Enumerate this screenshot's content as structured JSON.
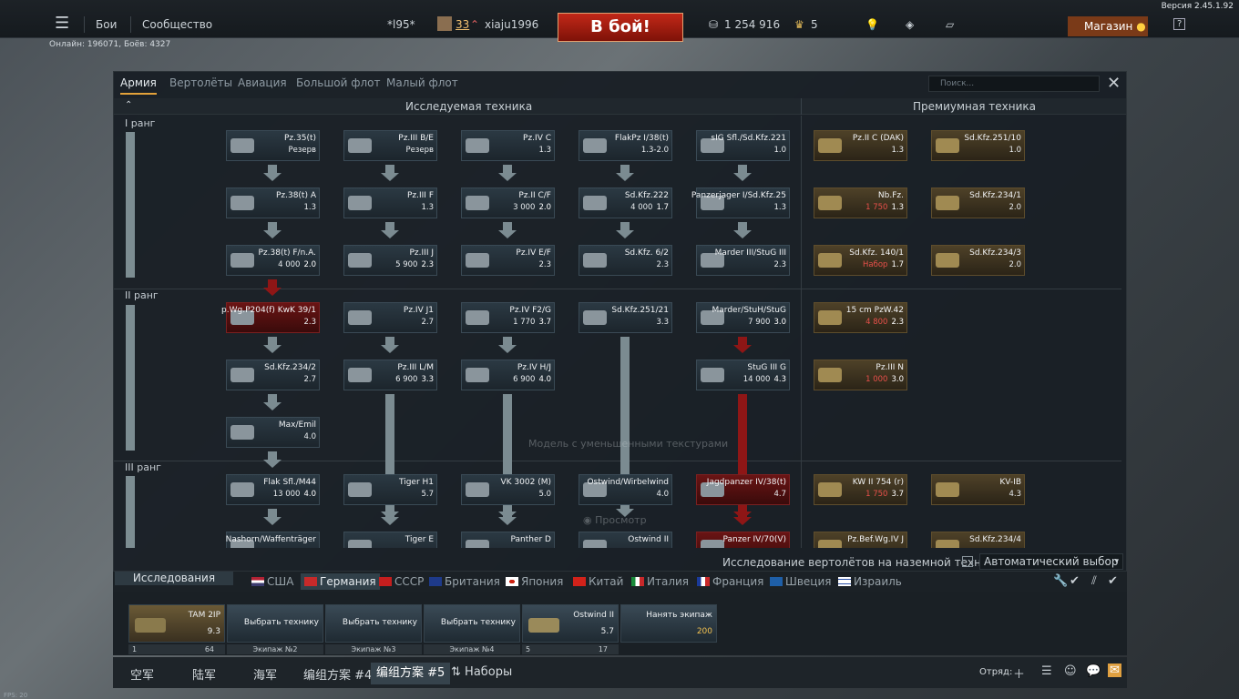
{
  "version": "Версия 2.45.1.92",
  "topbar": {
    "menu_icon": "hamburger-icon",
    "battles": "Бои",
    "community": "Сообщество",
    "squad_tag": "*l95*",
    "level": "33",
    "nickname": "xiaju1996",
    "battle_button": "В бой!",
    "silver": "1 254 916",
    "gold": "5",
    "shop": "Магазин",
    "help": "?"
  },
  "online": "Онлайн: 196071, Боёв: 4327",
  "window": {
    "tabs": [
      "Армия",
      "Вертолёты",
      "Авиация",
      "Большой флот",
      "Малый флот"
    ],
    "search_placeholder": "Поиск...",
    "researched_header": "Исследуемая техника",
    "premium_header": "Премиумная техника"
  },
  "ranks": [
    "I ранг",
    "II ранг",
    "III ранг"
  ],
  "vehicles": [
    {
      "name": "Pz.35(t)",
      "info": "Резерв",
      "br": "",
      "kind": "normal"
    },
    {
      "name": "Pz.III B/E",
      "info": "Резерв",
      "br": "",
      "kind": "normal"
    },
    {
      "name": "Pz.IV C",
      "info": "1.3",
      "br": "",
      "kind": "normal"
    },
    {
      "name": "FlakPz I/38(t)",
      "info": "1.3-2.0",
      "br": "",
      "kind": "normal"
    },
    {
      "name": "sIG Sfl./Sd.Kfz.221",
      "info": "1.0",
      "br": "",
      "kind": "normal"
    },
    {
      "name": "Pz.II C (DAK)",
      "info": "1.3",
      "br": "",
      "kind": "prem"
    },
    {
      "name": "Sd.Kfz.251/10",
      "info": "1.0",
      "br": "",
      "kind": "prem"
    },
    {
      "name": "Pz.38(t) A",
      "info": "1.3",
      "br": "",
      "kind": "normal"
    },
    {
      "name": "Pz.III F",
      "info": "1.3",
      "br": "",
      "kind": "normal"
    },
    {
      "name": "Pz.II C/F",
      "info": "3 000",
      "br": "2.0",
      "kind": "normal"
    },
    {
      "name": "Sd.Kfz.222",
      "info": "4 000",
      "br": "1.7",
      "kind": "normal"
    },
    {
      "name": "Panzerjager I/Sd.Kfz.25",
      "info": "1.3",
      "br": "",
      "kind": "normal"
    },
    {
      "name": "Nb.Fz.",
      "info": "1 750",
      "br": "1.3",
      "kind": "prem"
    },
    {
      "name": "Sd.Kfz.234/1",
      "info": "2.0",
      "br": "",
      "kind": "prem"
    },
    {
      "name": "Pz.38(t) F/n.A.",
      "info": "4 000",
      "br": "2.0",
      "kind": "normal"
    },
    {
      "name": "Pz.III J",
      "info": "5 900",
      "br": "2.3",
      "kind": "normal"
    },
    {
      "name": "Pz.IV E/F",
      "info": "2.3",
      "br": "",
      "kind": "normal"
    },
    {
      "name": "Sd.Kfz. 6/2",
      "info": "2.3",
      "br": "",
      "kind": "normal"
    },
    {
      "name": "Marder III/StuG III",
      "info": "2.3",
      "br": "",
      "kind": "normal"
    },
    {
      "name": "Sd.Kfz. 140/1",
      "info": "Набор",
      "br": "1.7",
      "kind": "prem"
    },
    {
      "name": "Sd.Kfz.234/3",
      "info": "2.0",
      "br": "",
      "kind": "prem"
    },
    {
      "name": "p.Wg.P204(f) KwK 39/1",
      "info": "2.3",
      "br": "",
      "kind": "red"
    },
    {
      "name": "Pz.IV J1",
      "info": "2.7",
      "br": "",
      "kind": "normal"
    },
    {
      "name": "Pz.IV F2/G",
      "info": "1 770",
      "br": "3.7",
      "kind": "normal"
    },
    {
      "name": "Sd.Kfz.251/21",
      "info": "3.3",
      "br": "",
      "kind": "normal"
    },
    {
      "name": "Marder/StuH/StuG",
      "info": "7 900",
      "br": "3.0",
      "kind": "normal"
    },
    {
      "name": "15 cm PzW.42",
      "info": "4 800",
      "br": "2.3",
      "kind": "prem"
    },
    {
      "name": "Sd.Kfz.234/2",
      "info": "2.7",
      "br": "",
      "kind": "normal"
    },
    {
      "name": "Pz.III L/M",
      "info": "6 900",
      "br": "3.3",
      "kind": "normal"
    },
    {
      "name": "Pz.IV H/J",
      "info": "6 900",
      "br": "4.0",
      "kind": "normal"
    },
    {
      "name": "StuG III G",
      "info": "14 000",
      "br": "4.3",
      "kind": "normal"
    },
    {
      "name": "Pz.III N",
      "info": "1 000",
      "br": "3.0",
      "kind": "prem"
    },
    {
      "name": "Max/Emil",
      "info": "4.0",
      "br": "",
      "kind": "normal"
    },
    {
      "name": "Flak Sfl./M44",
      "info": "13 000",
      "br": "4.0",
      "kind": "normal"
    },
    {
      "name": "Tiger H1",
      "info": "5.7",
      "br": "",
      "kind": "normal"
    },
    {
      "name": "VK 3002 (M)",
      "info": "5.0",
      "br": "",
      "kind": "normal"
    },
    {
      "name": "Ostwind/Wirbelwind",
      "info": "4.0",
      "br": "",
      "kind": "normal"
    },
    {
      "name": "Jagdpanzer IV/38(t)",
      "info": "4.7",
      "br": "",
      "kind": "red"
    },
    {
      "name": "KW II 754 (r)",
      "info": "1 750",
      "br": "3.7",
      "kind": "prem"
    },
    {
      "name": "KV-IB",
      "info": "4.3",
      "br": "",
      "kind": "prem"
    },
    {
      "name": "Nashorn/Waffenträger",
      "info": "",
      "br": "",
      "kind": "normal"
    },
    {
      "name": "Tiger E",
      "info": "",
      "br": "",
      "kind": "normal"
    },
    {
      "name": "Panther D",
      "info": "",
      "br": "",
      "kind": "normal"
    },
    {
      "name": "Ostwind II",
      "info": "",
      "br": "",
      "kind": "normal"
    },
    {
      "name": "Panzer IV/70(V)",
      "info": "",
      "br": "",
      "kind": "red"
    },
    {
      "name": "Pz.Bef.Wg.IV J",
      "info": "",
      "br": "",
      "kind": "prem"
    },
    {
      "name": "Sd.Kfz.234/4",
      "info": "",
      "br": "",
      "kind": "prem"
    }
  ],
  "overlay": {
    "low_textures": "Модель с уменьшенными текстурами",
    "preview": "Просмотр"
  },
  "options": {
    "heli_research": "Исследование вертолётов на наземной технике",
    "auto_select": "Автоматический выбор"
  },
  "nations": {
    "research_tab": "Исследования",
    "list": [
      "США",
      "Германия",
      "СССР",
      "Британия",
      "Япония",
      "Китай",
      "Италия",
      "Франция",
      "Швеция",
      "Израиль"
    ],
    "active": "Германия"
  },
  "crew": {
    "slots": [
      {
        "label": "TAM 2IP",
        "br": "9.3",
        "num": "1",
        "lvl": "64"
      },
      {
        "label": "Выбрать технику",
        "footer": "Экипаж №2"
      },
      {
        "label": "Выбрать технику",
        "footer": "Экипаж №3"
      },
      {
        "label": "Выбрать технику",
        "footer": "Экипаж №4"
      },
      {
        "label": "Ostwind II",
        "br": "5.7",
        "num": "5",
        "lvl": "17"
      },
      {
        "label": "Нанять экипаж",
        "cost": "200"
      }
    ]
  },
  "bottombar": {
    "tabs": [
      "空军",
      "陆军",
      "海军",
      "编组方案 #4",
      "编组方案 #5"
    ],
    "presets": "Наборы",
    "squad": "Отряд:"
  },
  "fps": "FPS: 20"
}
